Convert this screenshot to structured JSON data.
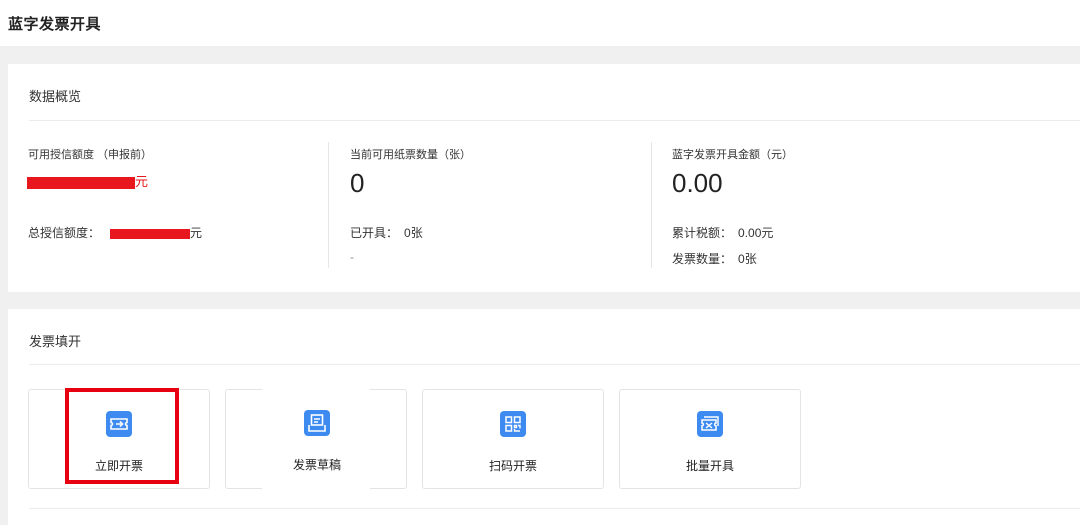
{
  "page": {
    "title": "蓝字发票开具"
  },
  "overview": {
    "title": "数据概览",
    "credit": {
      "label": "可用授信额度 （申报前）",
      "value_suffix": "元",
      "total_label": "总授信额度：",
      "total_suffix": "元"
    },
    "paper": {
      "label": "当前可用纸票数量（张）",
      "value": "0",
      "issued_label": "已开具：",
      "issued_value": "0张",
      "extra": "-"
    },
    "blue": {
      "label": "蓝字发票开具金额（元）",
      "value": "0.00",
      "tax_label": "累计税额：",
      "tax_value": "0.00元",
      "count_label": "发票数量：",
      "count_value": "0张"
    }
  },
  "issue": {
    "title": "发票填开",
    "tiles": [
      {
        "label": "立即开票",
        "icon": "ticket-icon"
      },
      {
        "label": "发票草稿",
        "icon": "draft-icon"
      },
      {
        "label": "扫码开票",
        "icon": "qrcode-icon"
      },
      {
        "label": "批量开具",
        "icon": "batch-ticket-icon"
      }
    ]
  },
  "colors": {
    "accent": "#3d8bf0",
    "redaction": "#e8171d",
    "highlight": "#e60012"
  }
}
